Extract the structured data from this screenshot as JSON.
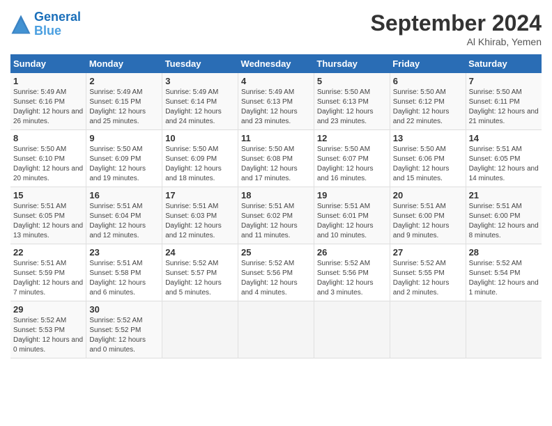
{
  "logo": {
    "line1": "General",
    "line2": "Blue"
  },
  "title": "September 2024",
  "location": "Al Khirab, Yemen",
  "days_header": [
    "Sunday",
    "Monday",
    "Tuesday",
    "Wednesday",
    "Thursday",
    "Friday",
    "Saturday"
  ],
  "weeks": [
    [
      {
        "day": "1",
        "sunrise": "Sunrise: 5:49 AM",
        "sunset": "Sunset: 6:16 PM",
        "daylight": "Daylight: 12 hours and 26 minutes."
      },
      {
        "day": "2",
        "sunrise": "Sunrise: 5:49 AM",
        "sunset": "Sunset: 6:15 PM",
        "daylight": "Daylight: 12 hours and 25 minutes."
      },
      {
        "day": "3",
        "sunrise": "Sunrise: 5:49 AM",
        "sunset": "Sunset: 6:14 PM",
        "daylight": "Daylight: 12 hours and 24 minutes."
      },
      {
        "day": "4",
        "sunrise": "Sunrise: 5:49 AM",
        "sunset": "Sunset: 6:13 PM",
        "daylight": "Daylight: 12 hours and 23 minutes."
      },
      {
        "day": "5",
        "sunrise": "Sunrise: 5:50 AM",
        "sunset": "Sunset: 6:13 PM",
        "daylight": "Daylight: 12 hours and 23 minutes."
      },
      {
        "day": "6",
        "sunrise": "Sunrise: 5:50 AM",
        "sunset": "Sunset: 6:12 PM",
        "daylight": "Daylight: 12 hours and 22 minutes."
      },
      {
        "day": "7",
        "sunrise": "Sunrise: 5:50 AM",
        "sunset": "Sunset: 6:11 PM",
        "daylight": "Daylight: 12 hours and 21 minutes."
      }
    ],
    [
      {
        "day": "8",
        "sunrise": "Sunrise: 5:50 AM",
        "sunset": "Sunset: 6:10 PM",
        "daylight": "Daylight: 12 hours and 20 minutes."
      },
      {
        "day": "9",
        "sunrise": "Sunrise: 5:50 AM",
        "sunset": "Sunset: 6:09 PM",
        "daylight": "Daylight: 12 hours and 19 minutes."
      },
      {
        "day": "10",
        "sunrise": "Sunrise: 5:50 AM",
        "sunset": "Sunset: 6:09 PM",
        "daylight": "Daylight: 12 hours and 18 minutes."
      },
      {
        "day": "11",
        "sunrise": "Sunrise: 5:50 AM",
        "sunset": "Sunset: 6:08 PM",
        "daylight": "Daylight: 12 hours and 17 minutes."
      },
      {
        "day": "12",
        "sunrise": "Sunrise: 5:50 AM",
        "sunset": "Sunset: 6:07 PM",
        "daylight": "Daylight: 12 hours and 16 minutes."
      },
      {
        "day": "13",
        "sunrise": "Sunrise: 5:50 AM",
        "sunset": "Sunset: 6:06 PM",
        "daylight": "Daylight: 12 hours and 15 minutes."
      },
      {
        "day": "14",
        "sunrise": "Sunrise: 5:51 AM",
        "sunset": "Sunset: 6:05 PM",
        "daylight": "Daylight: 12 hours and 14 minutes."
      }
    ],
    [
      {
        "day": "15",
        "sunrise": "Sunrise: 5:51 AM",
        "sunset": "Sunset: 6:05 PM",
        "daylight": "Daylight: 12 hours and 13 minutes."
      },
      {
        "day": "16",
        "sunrise": "Sunrise: 5:51 AM",
        "sunset": "Sunset: 6:04 PM",
        "daylight": "Daylight: 12 hours and 12 minutes."
      },
      {
        "day": "17",
        "sunrise": "Sunrise: 5:51 AM",
        "sunset": "Sunset: 6:03 PM",
        "daylight": "Daylight: 12 hours and 12 minutes."
      },
      {
        "day": "18",
        "sunrise": "Sunrise: 5:51 AM",
        "sunset": "Sunset: 6:02 PM",
        "daylight": "Daylight: 12 hours and 11 minutes."
      },
      {
        "day": "19",
        "sunrise": "Sunrise: 5:51 AM",
        "sunset": "Sunset: 6:01 PM",
        "daylight": "Daylight: 12 hours and 10 minutes."
      },
      {
        "day": "20",
        "sunrise": "Sunrise: 5:51 AM",
        "sunset": "Sunset: 6:00 PM",
        "daylight": "Daylight: 12 hours and 9 minutes."
      },
      {
        "day": "21",
        "sunrise": "Sunrise: 5:51 AM",
        "sunset": "Sunset: 6:00 PM",
        "daylight": "Daylight: 12 hours and 8 minutes."
      }
    ],
    [
      {
        "day": "22",
        "sunrise": "Sunrise: 5:51 AM",
        "sunset": "Sunset: 5:59 PM",
        "daylight": "Daylight: 12 hours and 7 minutes."
      },
      {
        "day": "23",
        "sunrise": "Sunrise: 5:51 AM",
        "sunset": "Sunset: 5:58 PM",
        "daylight": "Daylight: 12 hours and 6 minutes."
      },
      {
        "day": "24",
        "sunrise": "Sunrise: 5:52 AM",
        "sunset": "Sunset: 5:57 PM",
        "daylight": "Daylight: 12 hours and 5 minutes."
      },
      {
        "day": "25",
        "sunrise": "Sunrise: 5:52 AM",
        "sunset": "Sunset: 5:56 PM",
        "daylight": "Daylight: 12 hours and 4 minutes."
      },
      {
        "day": "26",
        "sunrise": "Sunrise: 5:52 AM",
        "sunset": "Sunset: 5:56 PM",
        "daylight": "Daylight: 12 hours and 3 minutes."
      },
      {
        "day": "27",
        "sunrise": "Sunrise: 5:52 AM",
        "sunset": "Sunset: 5:55 PM",
        "daylight": "Daylight: 12 hours and 2 minutes."
      },
      {
        "day": "28",
        "sunrise": "Sunrise: 5:52 AM",
        "sunset": "Sunset: 5:54 PM",
        "daylight": "Daylight: 12 hours and 1 minute."
      }
    ],
    [
      {
        "day": "29",
        "sunrise": "Sunrise: 5:52 AM",
        "sunset": "Sunset: 5:53 PM",
        "daylight": "Daylight: 12 hours and 0 minutes."
      },
      {
        "day": "30",
        "sunrise": "Sunrise: 5:52 AM",
        "sunset": "Sunset: 5:52 PM",
        "daylight": "Daylight: 12 hours and 0 minutes."
      },
      null,
      null,
      null,
      null,
      null
    ]
  ]
}
